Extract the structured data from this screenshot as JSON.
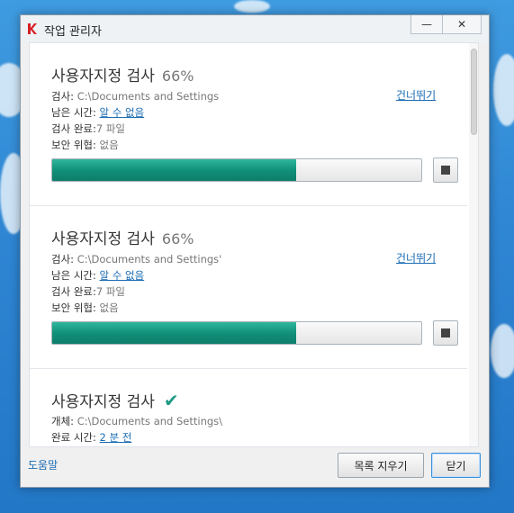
{
  "window": {
    "title": "작업 관리자",
    "minimize_label": "—",
    "close_label": "✕"
  },
  "tasks": [
    {
      "title": "사용자지정 검사",
      "percent": "66%",
      "progress": 0.66,
      "path_label": "검사",
      "path_value": "C:\\Documents and Settings",
      "time_label": "남은 시간",
      "time_value": "알 수 없음",
      "done_label": "검사 완료",
      "done_value": "7 파일",
      "threat_label": "보안 위협",
      "threat_value": "없음",
      "skip_label": "건너뛰기"
    },
    {
      "title": "사용자지정 검사",
      "percent": "66%",
      "progress": 0.66,
      "path_label": "검사",
      "path_value": "C:\\Documents and Settings'",
      "time_label": "남은 시간",
      "time_value": "알 수 없음",
      "done_label": "검사 완료",
      "done_value": "7 파일",
      "threat_label": "보안 위협",
      "threat_value": "없음",
      "skip_label": "건너뛰기"
    },
    {
      "title": "사용자지정 검사",
      "status_icon": "check-icon",
      "object_label": "개체",
      "object_value": "C:\\Documents and Settings\\",
      "finished_label": "완료 시간",
      "finished_value": "2 분 전"
    }
  ],
  "footer": {
    "help_label": "도움말",
    "clear_label": "목록 지우기",
    "close_label": "닫기"
  },
  "colors": {
    "accent": "#119079",
    "link": "#1b6cb3"
  }
}
